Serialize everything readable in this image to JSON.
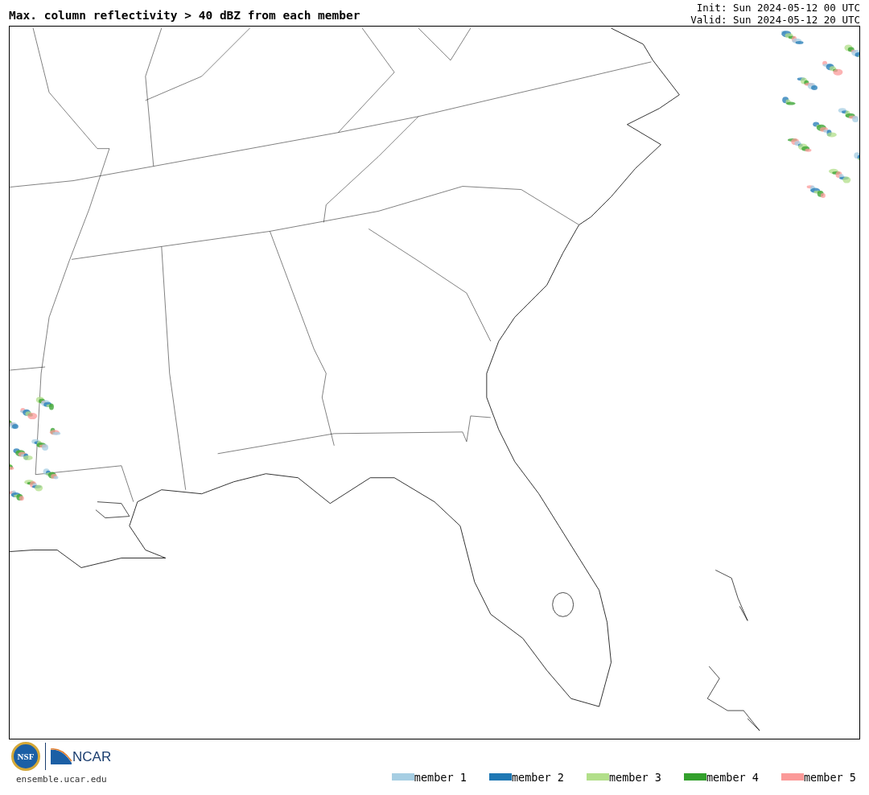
{
  "title": "Max. column reflectivity > 40 dBZ from each member",
  "run_info": [
    "Init: Sun 2024-05-12 00 UTC",
    "Valid: Sun 2024-05-12 20 UTC"
  ],
  "logos": {
    "nsf": "NSF",
    "ncar": "NCAR"
  },
  "site_url": "ensemble.ucar.edu",
  "legend": [
    {
      "label": "member 1",
      "color": "#a6cee3"
    },
    {
      "label": "member 2",
      "color": "#1f78b4"
    },
    {
      "label": "member 3",
      "color": "#b2df8a"
    },
    {
      "label": "member 4",
      "color": "#33a02c"
    },
    {
      "label": "member 5",
      "color": "#fb9a99"
    }
  ]
}
